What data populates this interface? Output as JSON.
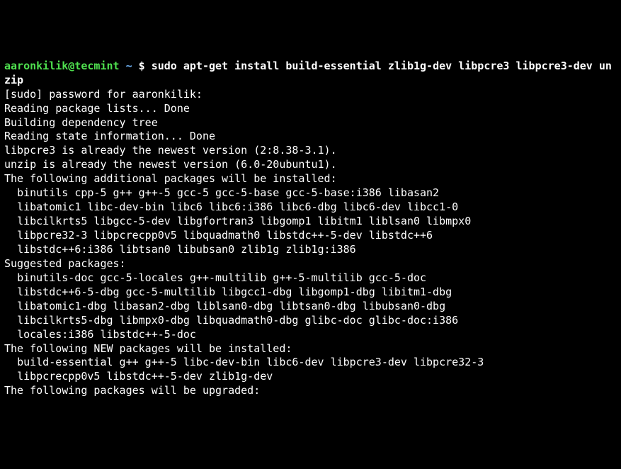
{
  "prompt": {
    "user_host": "aaronkilik@tecmint",
    "cwd": "~",
    "symbol": "$"
  },
  "command": "sudo apt-get install build-essential zlib1g-dev libpcre3 libpcre3-dev unzip",
  "output_lines": [
    "[sudo] password for aaronkilik: ",
    "Reading package lists... Done",
    "Building dependency tree       ",
    "Reading state information... Done",
    "libpcre3 is already the newest version (2:8.38-3.1).",
    "unzip is already the newest version (6.0-20ubuntu1).",
    "The following additional packages will be installed:",
    "  binutils cpp-5 g++ g++-5 gcc-5 gcc-5-base gcc-5-base:i386 libasan2",
    "  libatomic1 libc-dev-bin libc6 libc6:i386 libc6-dbg libc6-dev libcc1-0",
    "  libcilkrts5 libgcc-5-dev libgfortran3 libgomp1 libitm1 liblsan0 libmpx0",
    "  libpcre32-3 libpcrecpp0v5 libquadmath0 libstdc++-5-dev libstdc++6",
    "  libstdc++6:i386 libtsan0 libubsan0 zlib1g zlib1g:i386",
    "Suggested packages:",
    "  binutils-doc gcc-5-locales g++-multilib g++-5-multilib gcc-5-doc",
    "  libstdc++6-5-dbg gcc-5-multilib libgcc1-dbg libgomp1-dbg libitm1-dbg",
    "  libatomic1-dbg libasan2-dbg liblsan0-dbg libtsan0-dbg libubsan0-dbg",
    "  libcilkrts5-dbg libmpx0-dbg libquadmath0-dbg glibc-doc glibc-doc:i386",
    "  locales:i386 libstdc++-5-doc",
    "The following NEW packages will be installed:",
    "  build-essential g++ g++-5 libc-dev-bin libc6-dev libpcre3-dev libpcre32-3",
    "  libpcrecpp0v5 libstdc++-5-dev zlib1g-dev",
    "The following packages will be upgraded:"
  ]
}
